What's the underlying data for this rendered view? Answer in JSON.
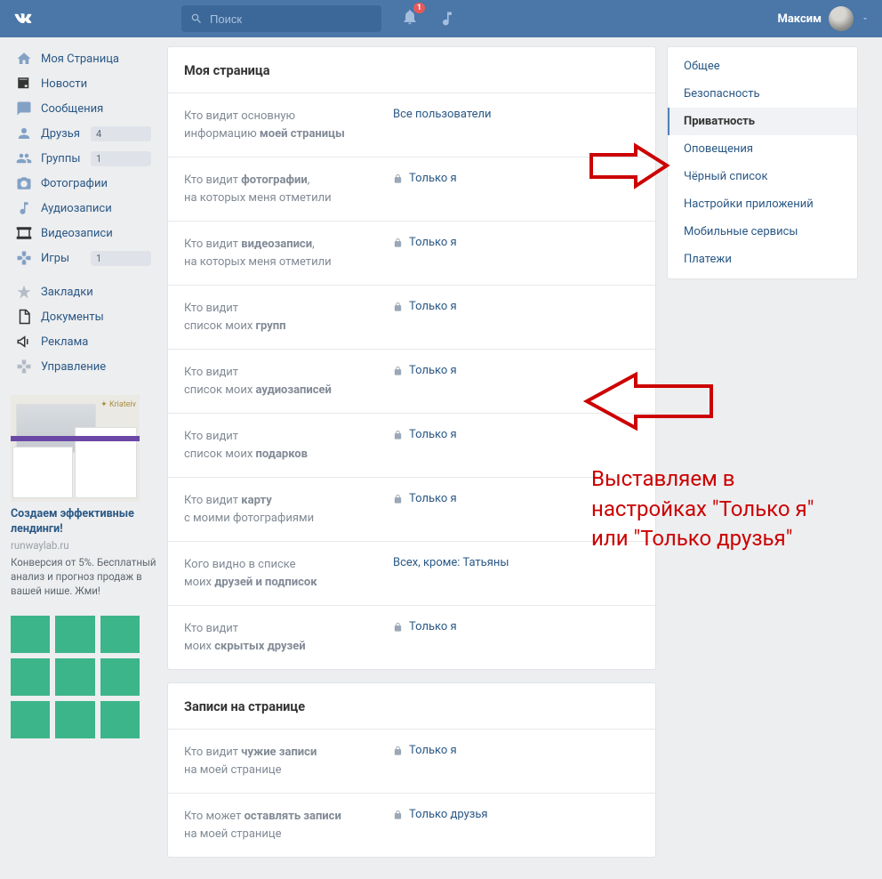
{
  "header": {
    "search_placeholder": "Поиск",
    "notif_count": "1",
    "user_name": "Максим"
  },
  "leftnav": {
    "items": [
      {
        "label": "Моя Страница",
        "icon": "home"
      },
      {
        "label": "Новости",
        "icon": "news"
      },
      {
        "label": "Сообщения",
        "icon": "msg"
      },
      {
        "label": "Друзья",
        "icon": "friends",
        "count": "4"
      },
      {
        "label": "Группы",
        "icon": "groups",
        "count": "1"
      },
      {
        "label": "Фотографии",
        "icon": "photo"
      },
      {
        "label": "Аудиозаписи",
        "icon": "audio"
      },
      {
        "label": "Видеозаписи",
        "icon": "video"
      },
      {
        "label": "Игры",
        "icon": "games",
        "count": "1"
      }
    ],
    "items2": [
      {
        "label": "Закладки"
      },
      {
        "label": "Документы"
      },
      {
        "label": "Реклама"
      },
      {
        "label": "Управление"
      }
    ]
  },
  "ad": {
    "title": "Создаем эффективные лендинги!",
    "domain": "runwaylab.ru",
    "text": "Конверсия от 5%. Бесплатный анализ и прогноз продаж в вашей нише. Жми!"
  },
  "settings": {
    "section1_title": "Моя страница",
    "rows1": [
      {
        "prefix": "Кто видит основную",
        "br": "информацию ",
        "bold": "моей страницы",
        "value": "Все пользователи",
        "lock": false
      },
      {
        "prefix": "Кто видит ",
        "bold": "фотографии",
        "suffix": ",",
        "br": "на которых меня отметили",
        "value": "Только я",
        "lock": true
      },
      {
        "prefix": "Кто видит ",
        "bold": "видеозаписи",
        "suffix": ",",
        "br": "на которых меня отметили",
        "value": "Только я",
        "lock": true
      },
      {
        "prefix": "Кто видит",
        "br": "список моих ",
        "bold": "групп",
        "value": "Только я",
        "lock": true
      },
      {
        "prefix": "Кто видит",
        "br": "список моих ",
        "bold": "аудиозаписей",
        "value": "Только я",
        "lock": true
      },
      {
        "prefix": "Кто видит",
        "br": "список моих ",
        "bold": "подарков",
        "value": "Только я",
        "lock": true
      },
      {
        "prefix": "Кто видит ",
        "bold": "карту",
        "br": "с моими фотографиями",
        "value": "Только я",
        "lock": true
      },
      {
        "prefix": "Кого видно в списке",
        "br": "моих ",
        "bold": "друзей и подписок",
        "value": "Всех, кроме: Татьяны",
        "lock": false
      },
      {
        "prefix": "Кто видит",
        "br": "моих ",
        "bold": "скрытых друзей",
        "value": "Только я",
        "lock": true
      }
    ],
    "section2_title": "Записи на странице",
    "rows2": [
      {
        "prefix": "Кто видит ",
        "bold": "чужие записи",
        "br": "на моей странице",
        "value": "Только я",
        "lock": true
      },
      {
        "prefix": "Кто может ",
        "bold": "оставлять записи",
        "br": "на моей странице",
        "value": "Только друзья",
        "lock": true
      }
    ]
  },
  "rightnav": {
    "items": [
      {
        "label": "Общее"
      },
      {
        "label": "Безопасность"
      },
      {
        "label": "Приватность",
        "active": true
      },
      {
        "label": "Оповещения"
      },
      {
        "label": "Чёрный список"
      },
      {
        "label": "Настройки приложений"
      },
      {
        "label": "Мобильные сервисы"
      },
      {
        "label": "Платежи"
      }
    ]
  },
  "anno": {
    "line1": "Выставляем в",
    "line2": "настройках \"Только я\"",
    "line3": "или \"Только друзья\""
  }
}
